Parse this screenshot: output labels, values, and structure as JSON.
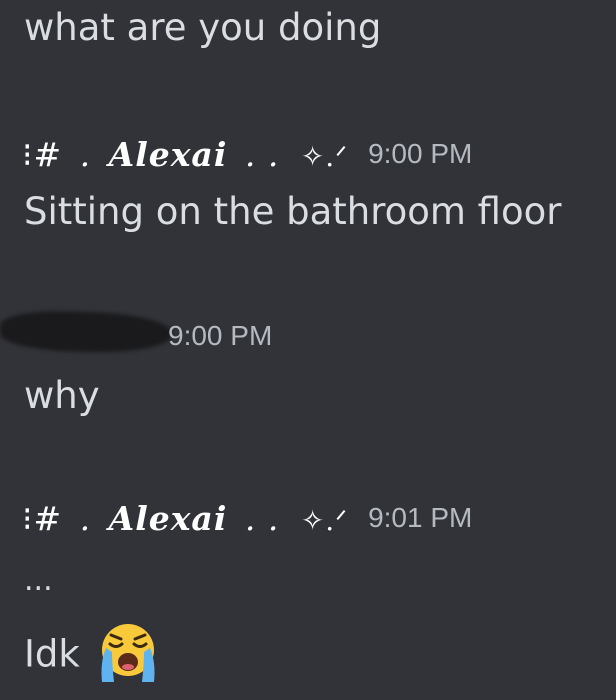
{
  "messages": [
    {
      "text": "what are you doing"
    },
    {
      "author": {
        "prefix": "⁝#",
        "name": "Alexai",
        "sep": ". .",
        "suffix": "✧.ᐟ"
      },
      "timestamp": "9:00 PM",
      "text": "Sitting on the bathroom floor"
    },
    {
      "author": {
        "name_redacted": true
      },
      "timestamp": "9:00 PM",
      "text": "why"
    },
    {
      "author": {
        "prefix": "⁝#",
        "name": "Alexai",
        "sep": ". .",
        "suffix": "✧.ᐟ"
      },
      "timestamp": "9:01 PM",
      "text_line1": "...",
      "text_line2": "Idk",
      "emoji": "loudly-crying-face-icon"
    }
  ],
  "colors": {
    "background": "#313338",
    "text": "#dbdee1",
    "timestamp": "#b5bac1",
    "username": "#ffffff"
  }
}
